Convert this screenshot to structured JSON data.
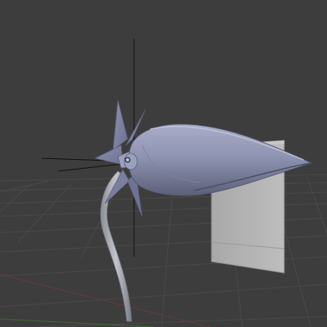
{
  "viewport": {
    "background_color": "#3d3d3d",
    "grid_color": "#4a4a4a",
    "x_axis_color": "#6b3a3a",
    "y_axis_color": "#3f6a2e"
  },
  "scene": {
    "flower_color": "#8e93b0",
    "stem_color": "#a7a9b0",
    "cube_color": "#b3b3b3",
    "objects": [
      "flower-bud",
      "petals",
      "stem",
      "cube",
      "lamp-empty"
    ]
  }
}
